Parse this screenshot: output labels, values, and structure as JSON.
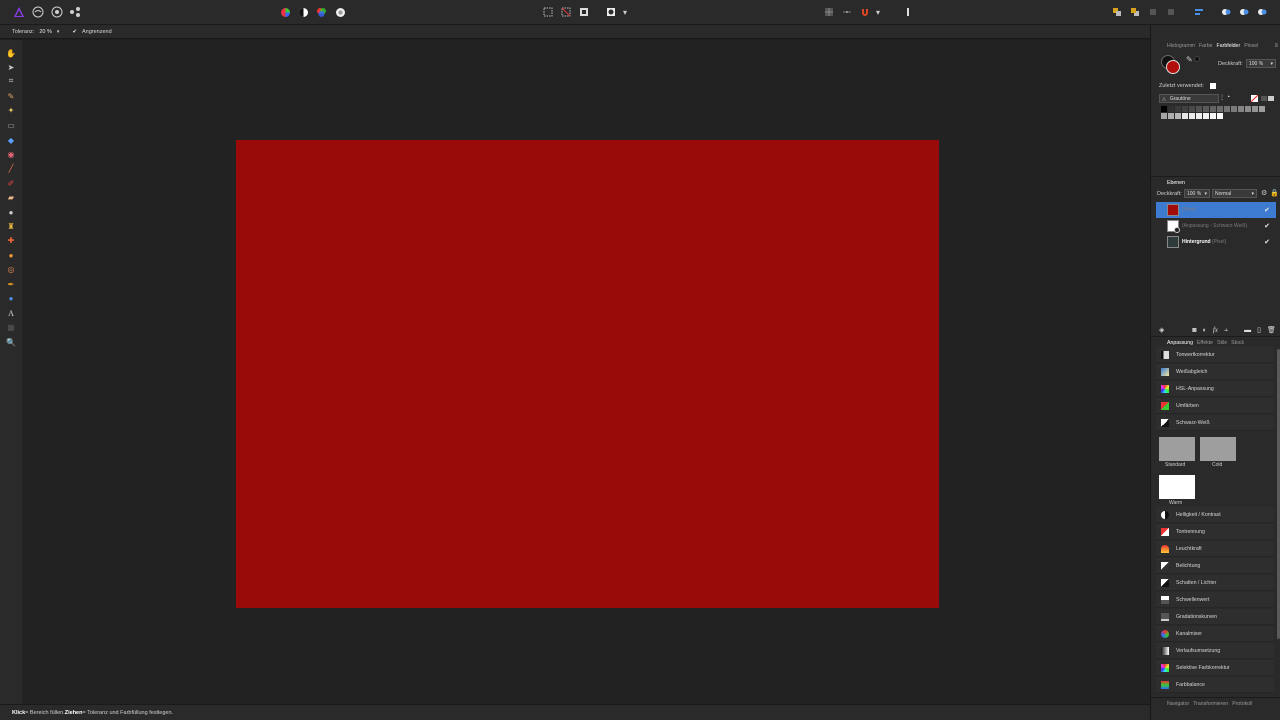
{
  "toolbar": {
    "personas": [
      {
        "name": "Photo Persona",
        "icon": "photo-persona-icon"
      },
      {
        "name": "Liquify Persona",
        "icon": "liquify-persona-icon"
      },
      {
        "name": "Develop Persona",
        "icon": "develop-persona-icon"
      },
      {
        "name": "Export Persona",
        "icon": "export-persona-icon"
      }
    ]
  },
  "context": {
    "tolerance_label": "Toleranz:",
    "tolerance_value": "20 %",
    "contiguous_label": "Angrenzend",
    "contiguous_checked": true
  },
  "document": {
    "fill_color": "#990b09"
  },
  "status": {
    "click": "Klick",
    "click_text": " = Bereich füllen. ",
    "drag": "Ziehen",
    "drag_text": " = Toleranz und Farbfüllung festlegen."
  },
  "top_panel": {
    "tabs": [
      "Histogramm",
      "Farbe",
      "Farbfelder",
      "Pinsel"
    ],
    "active_tab": "Farbfelder",
    "opacity_label": "Deckkraft:",
    "opacity_value": "100 %",
    "recent_label": "Zuletzt verwendet:",
    "palette_name": "Grautöne",
    "primary_color": "#b20f0c",
    "secondary_color": "#111111"
  },
  "layers_panel": {
    "tab": "Ebenen",
    "opacity_label": "Deckkraft:",
    "opacity_value": "100 %",
    "blend_mode": "Normal",
    "layers": [
      {
        "name": "",
        "type": "(Pixel)",
        "selected": true,
        "visible": true
      },
      {
        "name": "",
        "type": "(Anpassung - Schwarz-Weiß)",
        "selected": false,
        "visible": true
      },
      {
        "name": "Hintergrund",
        "type": "(Pixel)",
        "selected": false,
        "visible": true
      }
    ]
  },
  "adjust_panel": {
    "tabs": [
      "Anpassung",
      "Effekte",
      "Stile",
      "Stock"
    ],
    "active_tab": "Anpassung",
    "items_top": [
      "Tonwertkorrektur",
      "Weißabgleich",
      "HSL-Anpassung",
      "Umfärben",
      "Schwarz-Weiß"
    ],
    "presets": [
      "Standard",
      "Cold",
      "Warm"
    ],
    "items_bottom": [
      "Helligkeit / Kontrast",
      "Tontrennung",
      "Leuchtkraft",
      "Belichtung",
      "Schatten / Lichter",
      "Schwellenwert",
      "Gradationskurven",
      "Kanalmixer",
      "Verlaufsumsetzung",
      "Selektive Farbkorrektur",
      "Farbbalance"
    ]
  },
  "bottom_tabs": [
    "Navigator",
    "Transformieren",
    "Protokoll"
  ]
}
